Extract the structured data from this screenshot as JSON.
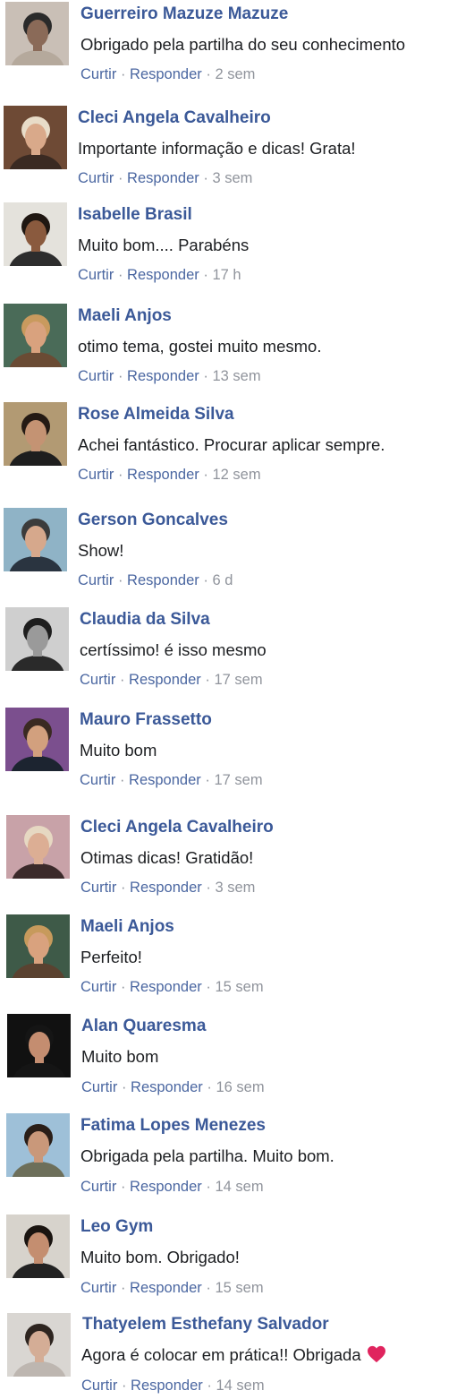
{
  "comments": [
    {
      "name": "Guerreiro Mazuze Mazuze",
      "text": "Obrigado pela partilha do seu conhecimento",
      "like": "Curtir",
      "reply": "Responder",
      "sep": "·",
      "time": "2 sem",
      "avatar": {
        "bg": "#c9bfb6",
        "skin": "#8a6a58",
        "hair": "#2a2a2a",
        "shirt": "#b5a99c"
      }
    },
    {
      "name": "Cleci Angela Cavalheiro",
      "text": "Importante informação e dicas! Grata!",
      "like": "Curtir",
      "reply": "Responder",
      "sep": "·",
      "time": "3 sem",
      "avatar": {
        "bg": "#6e4a35",
        "skin": "#d9a98a",
        "hair": "#e8dcc8",
        "shirt": "#3a2a22"
      }
    },
    {
      "name": "Isabelle Brasil",
      "text": "Muito bom.... Parabéns",
      "like": "Curtir",
      "reply": "Responder",
      "sep": "·",
      "time": "17 h",
      "avatar": {
        "bg": "#e4e2dc",
        "skin": "#8a5a3e",
        "hair": "#1f1712",
        "shirt": "#2d2d2d"
      }
    },
    {
      "name": "Maeli Anjos",
      "text": "otimo tema, gostei muito mesmo.",
      "like": "Curtir",
      "reply": "Responder",
      "sep": "·",
      "time": "13 sem",
      "avatar": {
        "bg": "#4a6b58",
        "skin": "#d9a27e",
        "hair": "#c99a5e",
        "shirt": "#6a4b34"
      }
    },
    {
      "name": "Rose Almeida Silva",
      "text": "Achei fantástico. Procurar aplicar sempre.",
      "like": "Curtir",
      "reply": "Responder",
      "sep": "·",
      "time": "12 sem",
      "avatar": {
        "bg": "#b29a73",
        "skin": "#c49373",
        "hair": "#241a14",
        "shirt": "#1e1e1e"
      }
    },
    {
      "name": "Gerson Goncalves",
      "text": "Show!",
      "like": "Curtir",
      "reply": "Responder",
      "sep": "·",
      "time": "6 d",
      "avatar": {
        "bg": "#8fb3c6",
        "skin": "#d6a88c",
        "hair": "#3b3b3b",
        "shirt": "#2a3440"
      }
    },
    {
      "name": "Claudia da Silva",
      "text": "certíssimo! é isso mesmo",
      "like": "Curtir",
      "reply": "Responder",
      "sep": "·",
      "time": "17 sem",
      "avatar": {
        "bg": "#cfcfcf",
        "skin": "#9a9a9a",
        "hair": "#1e1e1e",
        "shirt": "#2a2a2a"
      }
    },
    {
      "name": "Mauro Frassetto",
      "text": "Muito bom",
      "like": "Curtir",
      "reply": "Responder",
      "sep": "·",
      "time": "17 sem",
      "avatar": {
        "bg": "#7b4f8e",
        "skin": "#d2a07e",
        "hair": "#3a2a22",
        "shirt": "#1c2430"
      }
    },
    {
      "name": "Cleci Angela Cavalheiro",
      "text": "Otimas dicas! Gratidão!",
      "like": "Curtir",
      "reply": "Responder",
      "sep": "·",
      "time": "3 sem",
      "avatar": {
        "bg": "#c8a2a8",
        "skin": "#dcae94",
        "hair": "#e6d8c2",
        "shirt": "#3b2a2a"
      }
    },
    {
      "name": "Maeli Anjos",
      "text": "Perfeito!",
      "like": "Curtir",
      "reply": "Responder",
      "sep": "·",
      "time": "15 sem",
      "avatar": {
        "bg": "#3e5a48",
        "skin": "#d9a27e",
        "hair": "#c79a5c",
        "shirt": "#5a4230"
      }
    },
    {
      "name": "Alan Quaresma",
      "text": "Muito bom",
      "like": "Curtir",
      "reply": "Responder",
      "sep": "·",
      "time": "16 sem",
      "avatar": {
        "bg": "#111111",
        "skin": "#c48d70",
        "hair": "#151515",
        "shirt": "#151515"
      }
    },
    {
      "name": "Fatima Lopes Menezes",
      "text": "Obrigada pela partilha. Muito bom.",
      "like": "Curtir",
      "reply": "Responder",
      "sep": "·",
      "time": "14 sem",
      "avatar": {
        "bg": "#9ec0d8",
        "skin": "#c9987a",
        "hair": "#2a1e18",
        "shirt": "#6d6f5a"
      }
    },
    {
      "name": "Leo Gym",
      "text": "Muito bom. Obrigado!",
      "like": "Curtir",
      "reply": "Responder",
      "sep": "·",
      "time": "15 sem",
      "avatar": {
        "bg": "#d7d3cc",
        "skin": "#c48e70",
        "hair": "#1a1410",
        "shirt": "#222222"
      }
    },
    {
      "name": "Thatyelem Esthefany Salvador",
      "text": "Agora é colocar em prática!! Obrigada",
      "like": "Curtir",
      "reply": "Responder",
      "sep": "·",
      "time": "14 sem",
      "heart": true,
      "avatar": {
        "bg": "#d9d6d2",
        "skin": "#d4ad96",
        "hair": "#2e2520",
        "shirt": "#bdb6b0"
      }
    }
  ],
  "colors": {
    "name": "#3b5998",
    "link": "#4b67a1",
    "meta": "#90949c",
    "text": "#1c1e21",
    "heart": "#e0245e"
  },
  "icons": {
    "heart": "heart-emoji-icon"
  }
}
